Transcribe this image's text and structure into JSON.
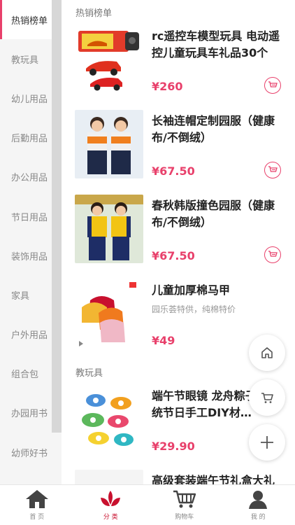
{
  "sidebar": {
    "items": [
      {
        "label": "热销榜单"
      },
      {
        "label": "教玩具"
      },
      {
        "label": "幼儿用品"
      },
      {
        "label": "后勤用品"
      },
      {
        "label": "办公用品"
      },
      {
        "label": "节日用品"
      },
      {
        "label": "装饰用品"
      },
      {
        "label": "家具"
      },
      {
        "label": "户外用品"
      },
      {
        "label": "组合包"
      },
      {
        "label": "办园用书"
      },
      {
        "label": "幼师好书"
      }
    ]
  },
  "sections": [
    {
      "title": "热销榜单",
      "products": [
        {
          "name": "rc遥控车模型玩具 电动遥控儿童玩具车礼品30个",
          "subtitle": "",
          "price": "¥260"
        },
        {
          "name": "长袖连帽定制园服（健康布/不倒绒）",
          "subtitle": "",
          "price": "¥67.50"
        },
        {
          "name": "春秋韩版撞色园服（健康布/不倒绒）",
          "subtitle": "",
          "price": "¥67.50"
        },
        {
          "name": "儿童加厚棉马甲",
          "subtitle": "园乐荟特供，纯棉特价",
          "price": "¥49"
        }
      ]
    },
    {
      "title": "教玩具",
      "products": [
        {
          "name": "端午节眼镜 龙舟粽子原传统节日手工DIY材…",
          "subtitle": "",
          "price": "¥29.90"
        },
        {
          "name": "高级套装端午节礼盒大礼包",
          "subtitle": "",
          "price": ""
        }
      ]
    }
  ],
  "tabbar": {
    "tabs": [
      {
        "label": "首 页"
      },
      {
        "label": "分 类"
      },
      {
        "label": "购物车"
      },
      {
        "label": "我 的"
      }
    ]
  },
  "colors": {
    "accent": "#e8406b",
    "tab_active": "#c8102e"
  }
}
